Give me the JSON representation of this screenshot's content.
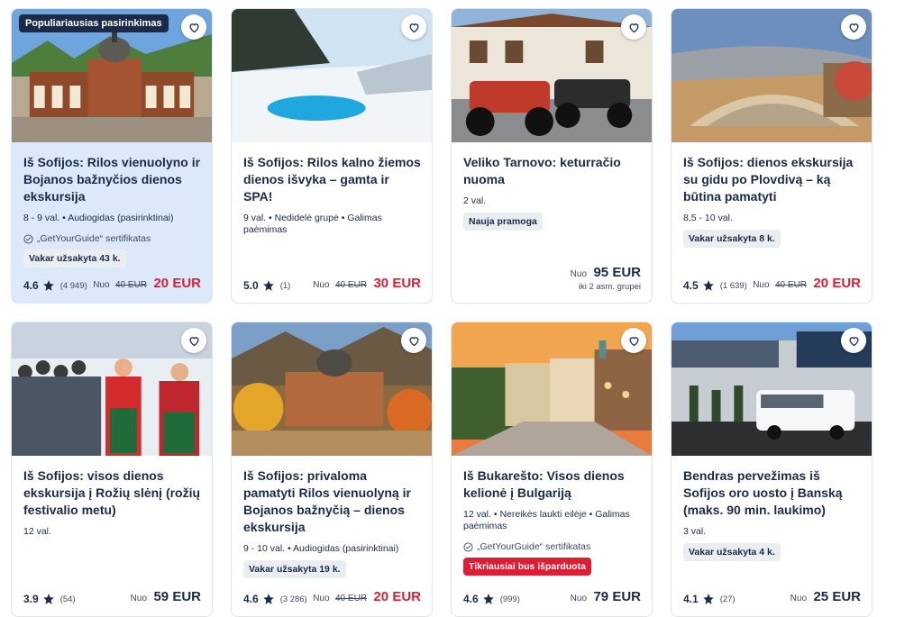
{
  "cards": [
    {
      "badge": "Populiariausias pasirinkimas",
      "title": "Iš Sofijos: Rilos vienuolyno ir Bojanos bažnyčios dienos ekskursija",
      "meta": "8 - 9 val. • Audiogidas (pasirinktinai)",
      "cert": "„GetYourGuide“ sertifikatas",
      "pill": "Vakar užsakyta 43 k.",
      "rating": "4.6",
      "reviews": "(4 949)",
      "from": "Nuo",
      "old_price": "40 EUR",
      "price": "20 EUR"
    },
    {
      "title": "Iš Sofijos: Rilos kalno žiemos dienos išvyka – gamta ir SPA!",
      "meta": "9 val. • Nedidelė grupė • Galimas paėmimas",
      "rating": "5.0",
      "reviews": "(1)",
      "from": "Nuo",
      "old_price": "40 EUR",
      "price": "30 EUR"
    },
    {
      "title": "Veliko Tarnovo: keturračio nuoma",
      "meta": "2 val.",
      "pill": "Nauja pramoga",
      "from": "Nuo",
      "price": "95 EUR",
      "price_note": "iki 2 asm. grupei"
    },
    {
      "title": "Iš Sofijos: dienos ekskursija su gidu po Plovdivą – ką būtina pamatyti",
      "meta": "8,5 - 10 val.",
      "pill": "Vakar užsakyta 8 k.",
      "rating": "4.5",
      "reviews": "(1 639)",
      "from": "Nuo",
      "old_price": "40 EUR",
      "price": "20 EUR"
    },
    {
      "title": "Iš Sofijos: visos dienos ekskursija į Rožių slėnį (rožių festivalio metu)",
      "meta": "12 val.",
      "rating": "3.9",
      "reviews": "(54)",
      "from": "Nuo",
      "price": "59 EUR"
    },
    {
      "title": "Iš Sofijos: privaloma pamatyti Rilos vienuolyną ir Bojanos bažnyčią – dienos ekskursija",
      "meta": "9 - 10 val. • Audiogidas (pasirinktinai)",
      "pill": "Vakar užsakyta 19 k.",
      "rating": "4.6",
      "reviews": "(3 286)",
      "from": "Nuo",
      "old_price": "40 EUR",
      "price": "20 EUR"
    },
    {
      "title": "Iš Bukarešto: Visos dienos kelionė į Bulgariją",
      "meta": "12 val. • Nereikės laukti eilėje • Galimas paėmimas",
      "cert": "„GetYourGuide“ sertifikatas",
      "pill": "Tikriausiai bus išparduota",
      "rating": "4.6",
      "reviews": "(999)",
      "from": "Nuo",
      "price": "79 EUR"
    },
    {
      "title": "Bendras pervežimas iš Sofijos oro uosto į Banską (maks. 90 min. laukimo)",
      "meta": "3 val.",
      "pill": "Vakar užsakyta 4 k.",
      "rating": "4.1",
      "reviews": "(27)",
      "from": "Nuo",
      "price": "25 EUR"
    }
  ],
  "colors": {
    "brand": "#1a2b49",
    "sale": "#dc1e35",
    "featured_bg": "#dbe9fb"
  },
  "icons": {
    "wishlist": "heart-icon",
    "rating": "star-icon",
    "certificate": "check-circle-icon"
  }
}
